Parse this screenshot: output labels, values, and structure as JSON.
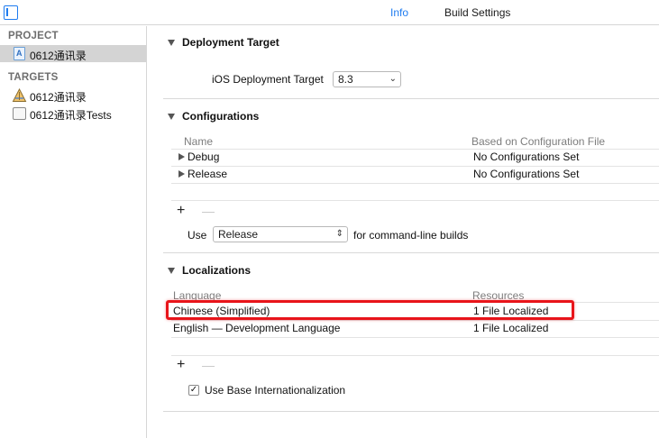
{
  "tabs": {
    "info": "Info",
    "build_settings": "Build Settings"
  },
  "sidebar": {
    "project_heading": "PROJECT",
    "project_item": "0612通讯录",
    "targets_heading": "TARGETS",
    "targets": [
      "0612通讯录",
      "0612通讯录Tests"
    ]
  },
  "deployment": {
    "title": "Deployment Target",
    "label": "iOS Deployment Target",
    "value": "8.3"
  },
  "configurations": {
    "title": "Configurations",
    "col_name": "Name",
    "col_based_on": "Based on Configuration File",
    "rows": [
      {
        "name": "Debug",
        "file": "No Configurations Set"
      },
      {
        "name": "Release",
        "file": "No Configurations Set"
      }
    ],
    "add": "+",
    "remove": "—",
    "use_label": "Use",
    "use_value": "Release",
    "use_suffix": "for command-line builds"
  },
  "localizations": {
    "title": "Localizations",
    "col_language": "Language",
    "col_resources": "Resources",
    "rows": [
      {
        "language": "Chinese (Simplified)",
        "resources": "1 File Localized"
      },
      {
        "language": "English — Development Language",
        "resources": "1 File Localized"
      }
    ],
    "add": "+",
    "remove": "—",
    "base_internationalization_label": "Use Base Internationalization",
    "base_internationalization_checked": true
  },
  "colors": {
    "accent": "#1f7cf0",
    "highlight": "#e8141a",
    "selection": "#d4d4d4"
  }
}
